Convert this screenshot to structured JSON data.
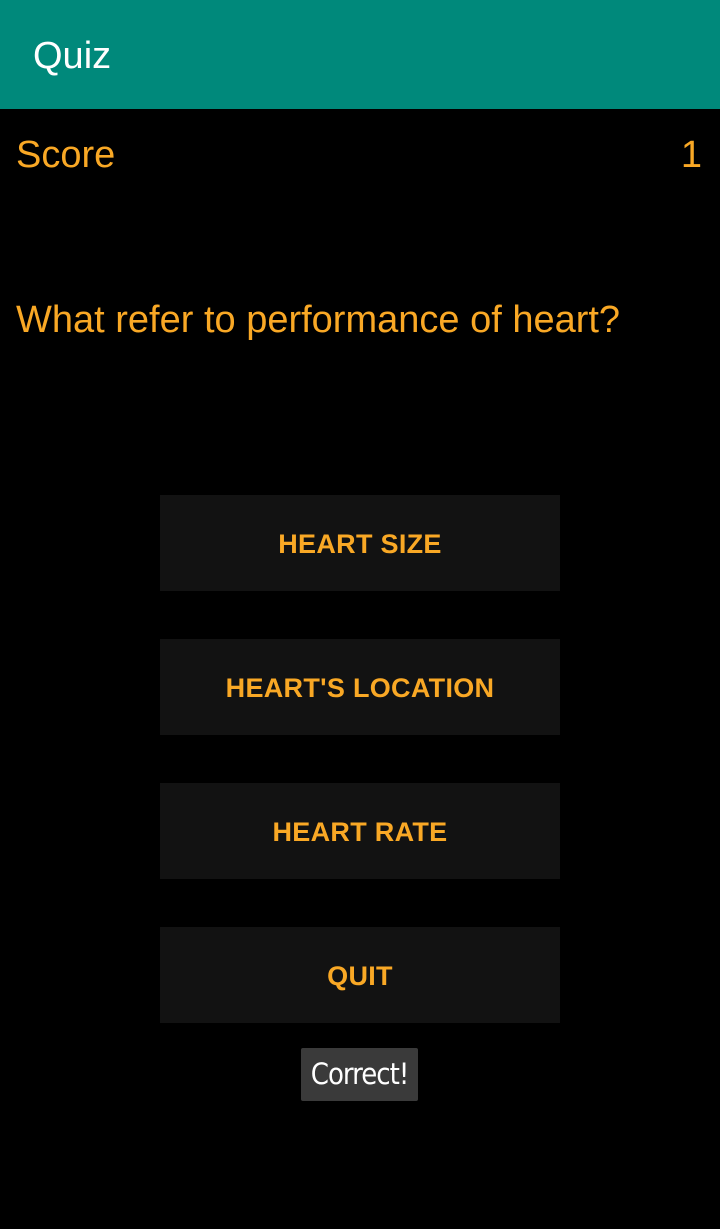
{
  "appbar": {
    "title": "Quiz",
    "color": "#00897B"
  },
  "score": {
    "label": "Score",
    "value": "1"
  },
  "question": {
    "text": "What refer to performance of heart?"
  },
  "answers": [
    {
      "label": "HEART SIZE"
    },
    {
      "label": "HEART'S LOCATION"
    },
    {
      "label": "HEART RATE"
    }
  ],
  "quit_label": "QUIT",
  "toast": {
    "message": "Correct!"
  },
  "colors": {
    "accent_text": "#F9A825",
    "button_bg": "#121212",
    "background": "#000000"
  }
}
